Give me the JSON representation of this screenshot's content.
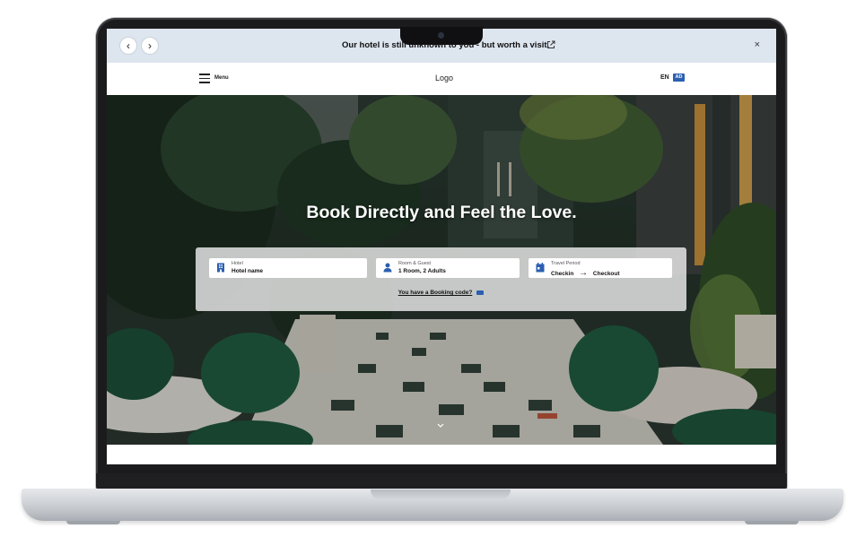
{
  "announcement": {
    "text": "Our hotel is still unknown to you - but worth a visit.",
    "prev_icon": "chevron-left-icon",
    "next_icon": "chevron-right-icon",
    "prev_glyph": "‹",
    "next_glyph": "›",
    "close_glyph": "×"
  },
  "header": {
    "menu_label": "Menu",
    "logo": "Logo",
    "language": "EN",
    "language_badge": "AD"
  },
  "hero": {
    "title": "Book Directly and Feel the Love."
  },
  "booking": {
    "hotel": {
      "label": "Hotel",
      "value": "Hotel name",
      "icon": "building-icon"
    },
    "guests": {
      "label": "Room & Guest",
      "value": "1 Room, 2 Adults",
      "icon": "person-icon"
    },
    "period": {
      "label": "Travel Period",
      "checkin": "Checkin",
      "arrow": "→",
      "checkout": "Checkout",
      "icon": "calendar-icon"
    },
    "code_link": "You have a Booking code?"
  },
  "colors": {
    "announce_bg": "#dde5ef",
    "accent_blue": "#2b5fb0",
    "hero_overlay": "#213027"
  }
}
